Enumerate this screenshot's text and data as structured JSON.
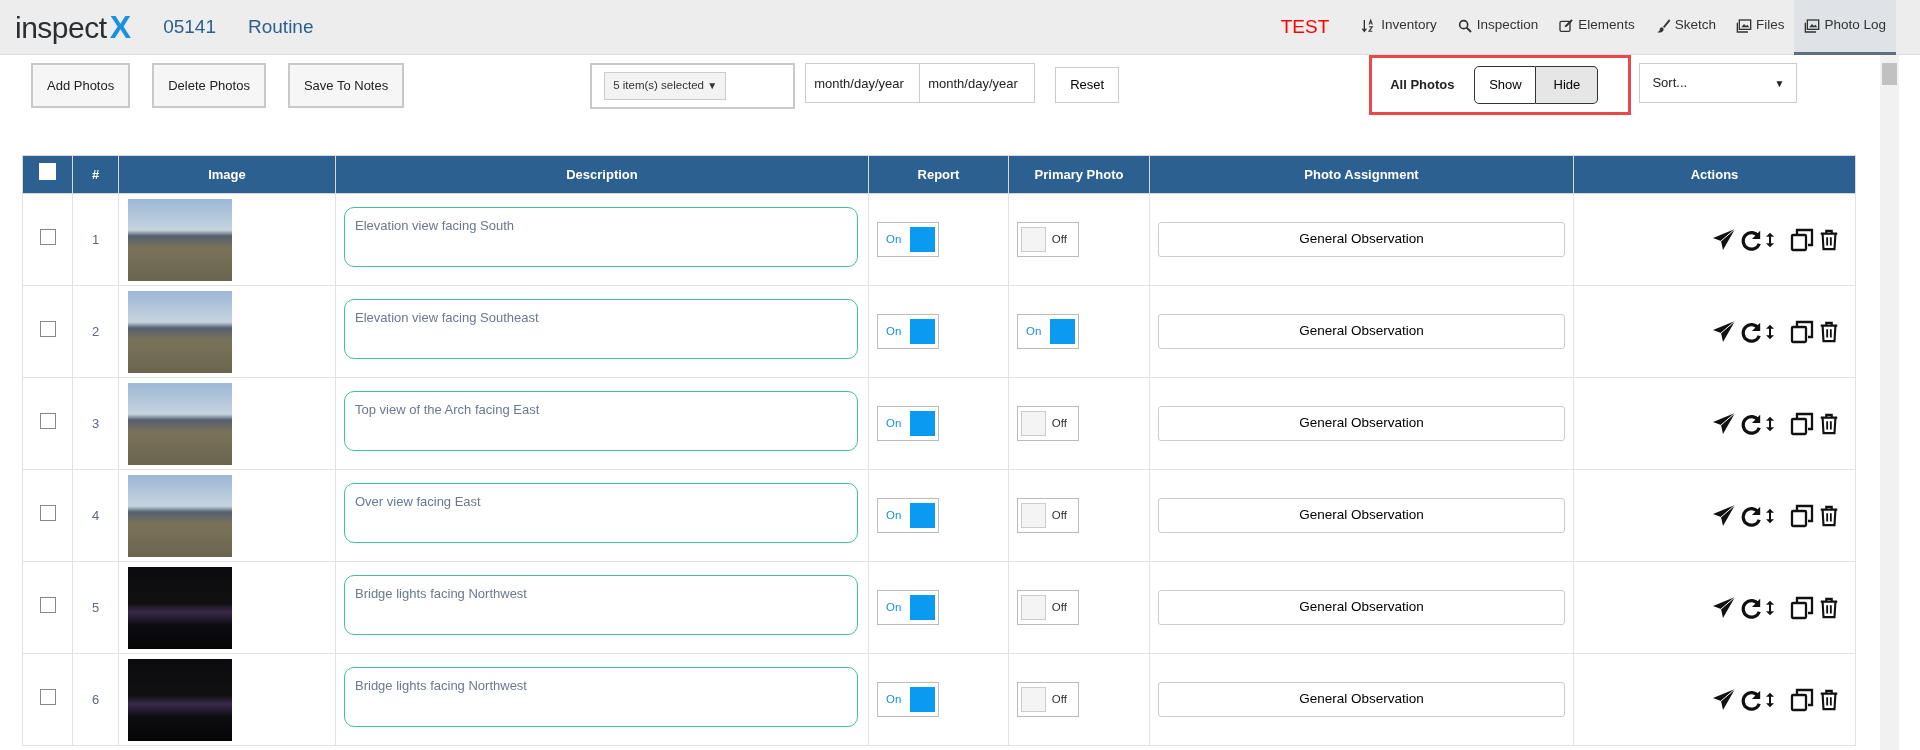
{
  "app": {
    "logo_text": "inspect",
    "logo_mark": "X",
    "structure_id": "05141",
    "inspection_type": "Routine",
    "environment": "TEST"
  },
  "nav": [
    {
      "label": "Inventory",
      "kind": "sort",
      "selected": false
    },
    {
      "label": "Inspection",
      "kind": "search",
      "selected": false
    },
    {
      "label": "Elements",
      "kind": "edit",
      "selected": false
    },
    {
      "label": "Sketch",
      "kind": "brush",
      "selected": false
    },
    {
      "label": "Files",
      "kind": "images",
      "selected": false
    },
    {
      "label": "Photo Log",
      "kind": "images",
      "selected": true
    }
  ],
  "toolbar": {
    "buttons": [
      "Add Photos",
      "Delete Photos",
      "Save To Notes"
    ],
    "filter": "5 item(s) selected",
    "filter_caret": "▼",
    "date_from": {
      "placeholder": "month/day/year"
    },
    "date_to": {
      "placeholder": "month/day/year"
    },
    "reset": "Reset",
    "all_photos_label": "All Photos",
    "visibility": [
      {
        "label": "Show",
        "selected": false
      },
      {
        "label": "Hide",
        "selected": true
      }
    ],
    "sort": {
      "value": "Sort...",
      "caret": "▼"
    }
  },
  "table": {
    "select_all_checked": false,
    "columns": [
      "#",
      "Image",
      "Description",
      "Report",
      "Primary Photo",
      "Photo Assignment",
      "Actions"
    ],
    "rows": [
      {
        "selected": false,
        "number": "1",
        "night_photo": false,
        "description": "Elevation view facing South",
        "report": true,
        "report_label": "On",
        "primary": false,
        "primary_label": "Off",
        "assignment": "General Observation"
      },
      {
        "selected": false,
        "number": "2",
        "night_photo": false,
        "description": "Elevation view facing Southeast",
        "report": true,
        "report_label": "On",
        "primary": true,
        "primary_label": "On",
        "assignment": "General Observation"
      },
      {
        "selected": false,
        "number": "3",
        "night_photo": false,
        "description": "Top view of the Arch facing East",
        "report": true,
        "report_label": "On",
        "primary": false,
        "primary_label": "Off",
        "assignment": "General Observation"
      },
      {
        "selected": false,
        "number": "4",
        "night_photo": false,
        "description": "Over view facing East",
        "report": true,
        "report_label": "On",
        "primary": false,
        "primary_label": "Off",
        "assignment": "General Observation"
      },
      {
        "selected": false,
        "number": "5",
        "night_photo": true,
        "description": "Bridge lights facing Northwest",
        "report": true,
        "report_label": "On",
        "primary": false,
        "primary_label": "Off",
        "assignment": "General Observation"
      },
      {
        "selected": false,
        "number": "6",
        "night_photo": true,
        "description": "Bridge lights facing Northwest",
        "report": true,
        "report_label": "On",
        "primary": false,
        "primary_label": "Off",
        "assignment": "General Observation"
      }
    ]
  }
}
